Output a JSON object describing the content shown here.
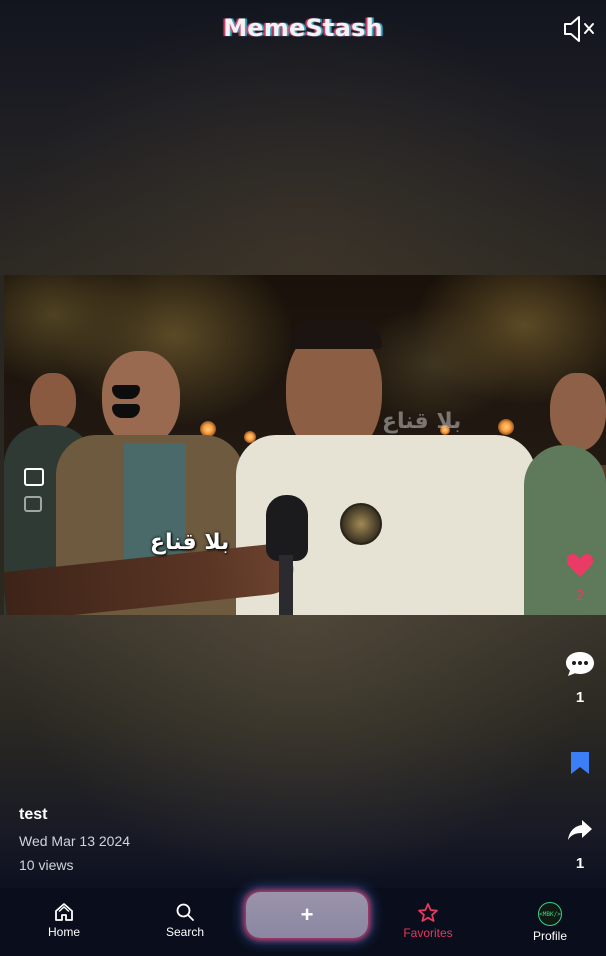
{
  "app": {
    "logo_text": "MemeStash",
    "brand_colors": {
      "pink": "#e93b65",
      "cyan": "#46c8eb",
      "favorite_red": "#e5395e",
      "save_blue": "#3b7ef5"
    }
  },
  "post": {
    "title": "test",
    "date": "Wed Mar 13 2024",
    "views": "10 views",
    "video_caption": "بلا قناع",
    "video_watermark": "بلا قناع",
    "likes": "2",
    "comments": "1",
    "shares": "1",
    "liked": true,
    "saved": true
  },
  "controls": {
    "mute_icon": "speaker-muted-icon",
    "like_icon": "heart-icon",
    "comment_icon": "speech-bubble-icon",
    "save_icon": "bookmark-icon",
    "share_icon": "share-arrow-icon"
  },
  "nav": {
    "items": [
      {
        "label": "Home",
        "icon": "home-icon"
      },
      {
        "label": "Search",
        "icon": "search-icon"
      },
      {
        "label": "Favorites",
        "icon": "star-icon",
        "active": true
      },
      {
        "label": "Profile",
        "icon": "avatar-icon",
        "avatar_text": "<MBK/>"
      }
    ],
    "create_label": "+"
  }
}
